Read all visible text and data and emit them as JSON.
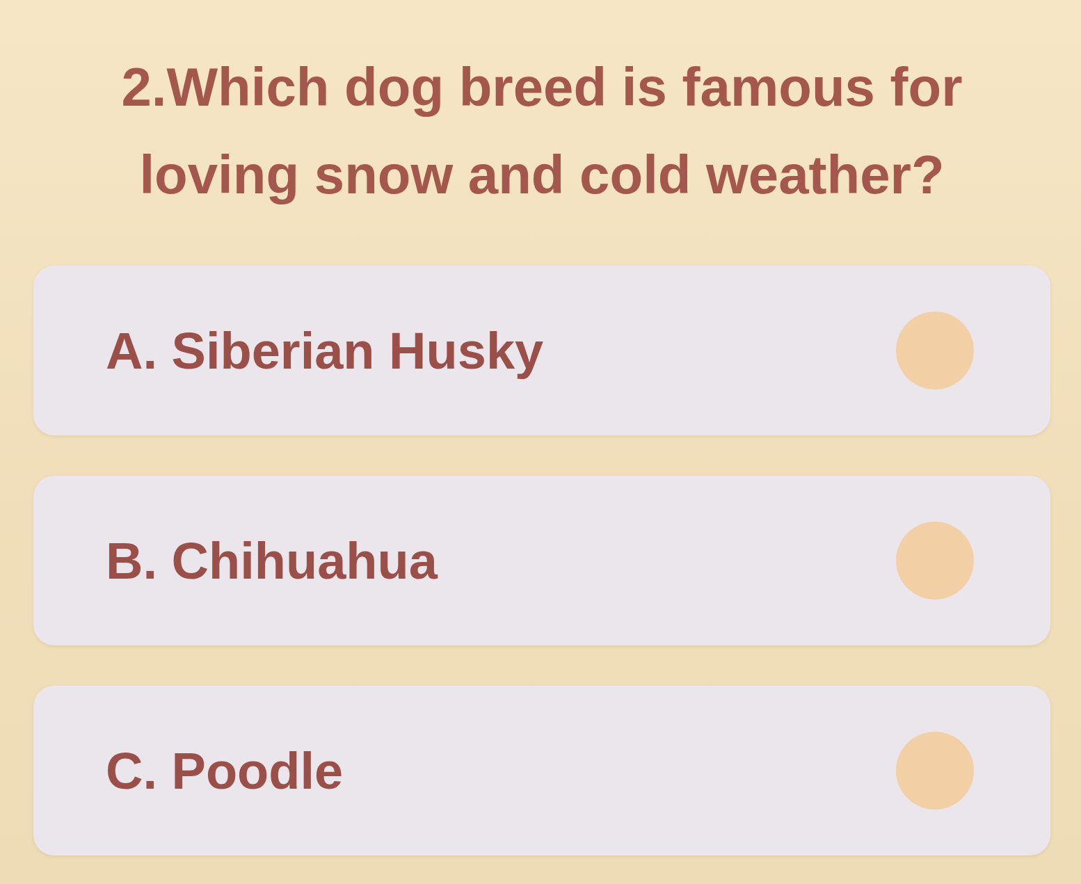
{
  "question": "2.Which dog breed is famous for loving snow and cold weather?",
  "options": [
    {
      "label": "A. Siberian Husky",
      "selected": false
    },
    {
      "label": "B. Chihuahua",
      "selected": false
    },
    {
      "label": "C. Poodle",
      "selected": false
    }
  ]
}
